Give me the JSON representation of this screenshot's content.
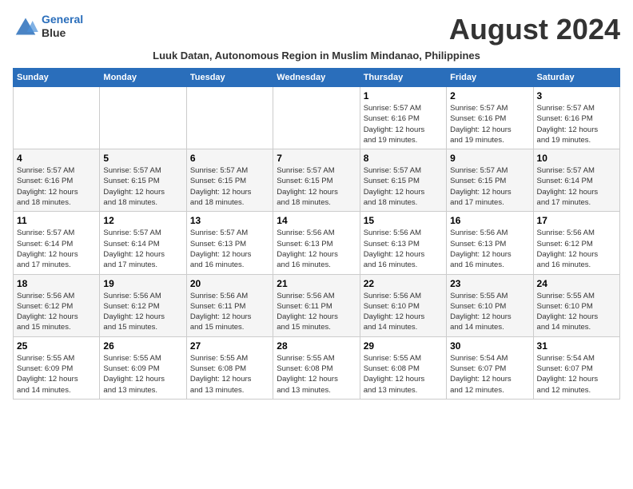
{
  "logo": {
    "line1": "General",
    "line2": "Blue"
  },
  "title": "August 2024",
  "subtitle": "Luuk Datan, Autonomous Region in Muslim Mindanao, Philippines",
  "header": {
    "days": [
      "Sunday",
      "Monday",
      "Tuesday",
      "Wednesday",
      "Thursday",
      "Friday",
      "Saturday"
    ]
  },
  "weeks": [
    {
      "cells": [
        {
          "day": "",
          "info": ""
        },
        {
          "day": "",
          "info": ""
        },
        {
          "day": "",
          "info": ""
        },
        {
          "day": "",
          "info": ""
        },
        {
          "day": "1",
          "info": "Sunrise: 5:57 AM\nSunset: 6:16 PM\nDaylight: 12 hours\nand 19 minutes."
        },
        {
          "day": "2",
          "info": "Sunrise: 5:57 AM\nSunset: 6:16 PM\nDaylight: 12 hours\nand 19 minutes."
        },
        {
          "day": "3",
          "info": "Sunrise: 5:57 AM\nSunset: 6:16 PM\nDaylight: 12 hours\nand 19 minutes."
        }
      ]
    },
    {
      "cells": [
        {
          "day": "4",
          "info": "Sunrise: 5:57 AM\nSunset: 6:16 PM\nDaylight: 12 hours\nand 18 minutes."
        },
        {
          "day": "5",
          "info": "Sunrise: 5:57 AM\nSunset: 6:15 PM\nDaylight: 12 hours\nand 18 minutes."
        },
        {
          "day": "6",
          "info": "Sunrise: 5:57 AM\nSunset: 6:15 PM\nDaylight: 12 hours\nand 18 minutes."
        },
        {
          "day": "7",
          "info": "Sunrise: 5:57 AM\nSunset: 6:15 PM\nDaylight: 12 hours\nand 18 minutes."
        },
        {
          "day": "8",
          "info": "Sunrise: 5:57 AM\nSunset: 6:15 PM\nDaylight: 12 hours\nand 18 minutes."
        },
        {
          "day": "9",
          "info": "Sunrise: 5:57 AM\nSunset: 6:15 PM\nDaylight: 12 hours\nand 17 minutes."
        },
        {
          "day": "10",
          "info": "Sunrise: 5:57 AM\nSunset: 6:14 PM\nDaylight: 12 hours\nand 17 minutes."
        }
      ]
    },
    {
      "cells": [
        {
          "day": "11",
          "info": "Sunrise: 5:57 AM\nSunset: 6:14 PM\nDaylight: 12 hours\nand 17 minutes."
        },
        {
          "day": "12",
          "info": "Sunrise: 5:57 AM\nSunset: 6:14 PM\nDaylight: 12 hours\nand 17 minutes."
        },
        {
          "day": "13",
          "info": "Sunrise: 5:57 AM\nSunset: 6:13 PM\nDaylight: 12 hours\nand 16 minutes."
        },
        {
          "day": "14",
          "info": "Sunrise: 5:56 AM\nSunset: 6:13 PM\nDaylight: 12 hours\nand 16 minutes."
        },
        {
          "day": "15",
          "info": "Sunrise: 5:56 AM\nSunset: 6:13 PM\nDaylight: 12 hours\nand 16 minutes."
        },
        {
          "day": "16",
          "info": "Sunrise: 5:56 AM\nSunset: 6:13 PM\nDaylight: 12 hours\nand 16 minutes."
        },
        {
          "day": "17",
          "info": "Sunrise: 5:56 AM\nSunset: 6:12 PM\nDaylight: 12 hours\nand 16 minutes."
        }
      ]
    },
    {
      "cells": [
        {
          "day": "18",
          "info": "Sunrise: 5:56 AM\nSunset: 6:12 PM\nDaylight: 12 hours\nand 15 minutes."
        },
        {
          "day": "19",
          "info": "Sunrise: 5:56 AM\nSunset: 6:12 PM\nDaylight: 12 hours\nand 15 minutes."
        },
        {
          "day": "20",
          "info": "Sunrise: 5:56 AM\nSunset: 6:11 PM\nDaylight: 12 hours\nand 15 minutes."
        },
        {
          "day": "21",
          "info": "Sunrise: 5:56 AM\nSunset: 6:11 PM\nDaylight: 12 hours\nand 15 minutes."
        },
        {
          "day": "22",
          "info": "Sunrise: 5:56 AM\nSunset: 6:10 PM\nDaylight: 12 hours\nand 14 minutes."
        },
        {
          "day": "23",
          "info": "Sunrise: 5:55 AM\nSunset: 6:10 PM\nDaylight: 12 hours\nand 14 minutes."
        },
        {
          "day": "24",
          "info": "Sunrise: 5:55 AM\nSunset: 6:10 PM\nDaylight: 12 hours\nand 14 minutes."
        }
      ]
    },
    {
      "cells": [
        {
          "day": "25",
          "info": "Sunrise: 5:55 AM\nSunset: 6:09 PM\nDaylight: 12 hours\nand 14 minutes."
        },
        {
          "day": "26",
          "info": "Sunrise: 5:55 AM\nSunset: 6:09 PM\nDaylight: 12 hours\nand 13 minutes."
        },
        {
          "day": "27",
          "info": "Sunrise: 5:55 AM\nSunset: 6:08 PM\nDaylight: 12 hours\nand 13 minutes."
        },
        {
          "day": "28",
          "info": "Sunrise: 5:55 AM\nSunset: 6:08 PM\nDaylight: 12 hours\nand 13 minutes."
        },
        {
          "day": "29",
          "info": "Sunrise: 5:55 AM\nSunset: 6:08 PM\nDaylight: 12 hours\nand 13 minutes."
        },
        {
          "day": "30",
          "info": "Sunrise: 5:54 AM\nSunset: 6:07 PM\nDaylight: 12 hours\nand 12 minutes."
        },
        {
          "day": "31",
          "info": "Sunrise: 5:54 AM\nSunset: 6:07 PM\nDaylight: 12 hours\nand 12 minutes."
        }
      ]
    }
  ]
}
